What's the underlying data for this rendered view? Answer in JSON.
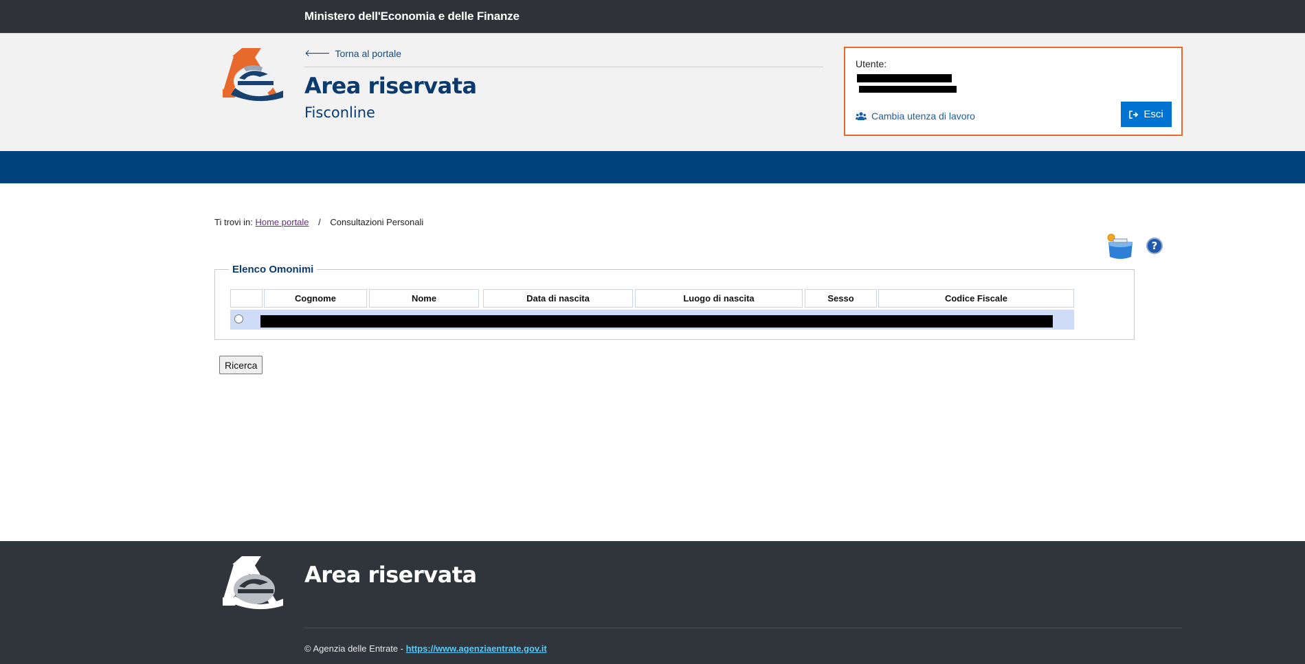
{
  "topbar": {
    "ministry": "Ministero dell'Economia e delle Finanze"
  },
  "header": {
    "back_link": "Torna al portale",
    "title": "Area riservata",
    "subtitle": "Fisconline",
    "user_label": "Utente:",
    "switch_label": "Cambia utenza di lavoro",
    "logout_label": "Esci"
  },
  "breadcrumb": {
    "prefix": "Ti trovi in:",
    "home": "Home portale",
    "separator": "/",
    "current": "Consultazioni Personali"
  },
  "table": {
    "legend": "Elenco Omonimi",
    "columns": [
      "",
      "Cognome",
      "Nome",
      "Data di nascita",
      "Luogo di nascita",
      "Sesso",
      "Codice Fiscale"
    ]
  },
  "actions": {
    "search": "Ricerca"
  },
  "footer": {
    "title": "Area riservata",
    "copyright": "© Agenzia delle Entrate - ",
    "url": "https://www.agenziaentrate.gov.it"
  },
  "colors": {
    "accent_orange": "#e8692c",
    "brand_blue": "#00427e",
    "button_blue": "#0073d1",
    "row_highlight": "#cfdcf7"
  }
}
